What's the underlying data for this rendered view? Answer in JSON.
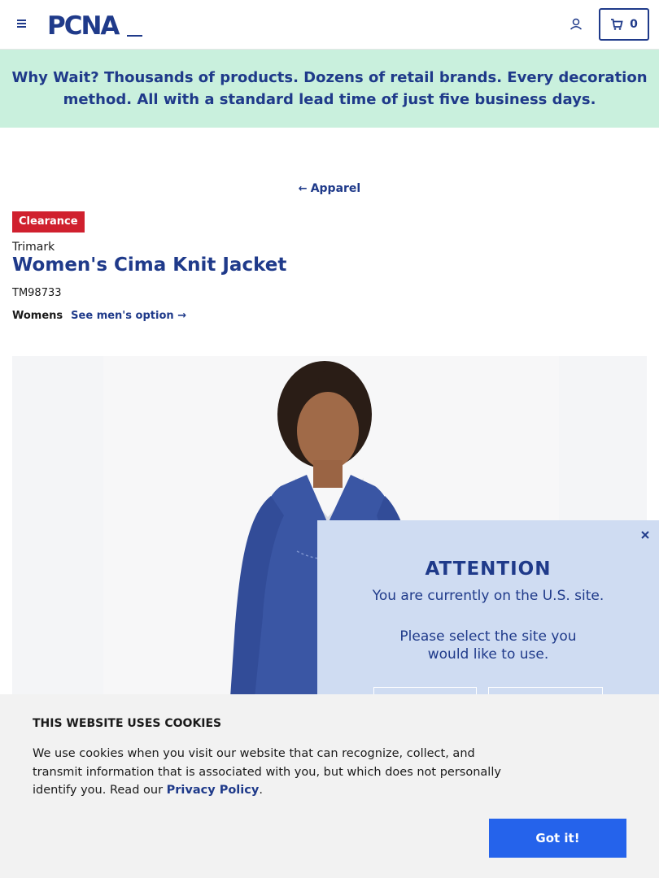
{
  "header": {
    "logo_text": "PCNA",
    "cart_count": "0",
    "brand_color": "#1f3a8a"
  },
  "promo": {
    "text": "Why Wait? Thousands of products. Dozens of retail brands. Every decoration method. All with a standard lead time of just five business days.",
    "background": "#c9f0dd"
  },
  "breadcrumb": {
    "back_label": "Apparel"
  },
  "product": {
    "badge": "Clearance",
    "brand": "Trimark",
    "title": "Women's Cima Knit Jacket",
    "sku": "TM98733",
    "gender_current": "Womens",
    "gender_alt_link": "See men's option"
  },
  "attention_modal": {
    "title": "ATTENTION",
    "line1": "You are currently on the U.S. site.",
    "line2": "Please select the site you would like to use."
  },
  "cookie_banner": {
    "title": "THIS WEBSITE USES COOKIES",
    "text_before_link": "We use cookies when you visit our website that can recognize, collect, and transmit information that is associated with you, but which does not personally identify you. Read our ",
    "link_label": "Privacy Policy",
    "text_after_link": ".",
    "button_label": "Got it!"
  },
  "icons": {
    "menu": "hamburger-icon",
    "account": "user-icon",
    "cart": "cart-icon",
    "back": "arrow-left-icon",
    "forward": "arrow-right-icon",
    "close": "close-icon"
  }
}
